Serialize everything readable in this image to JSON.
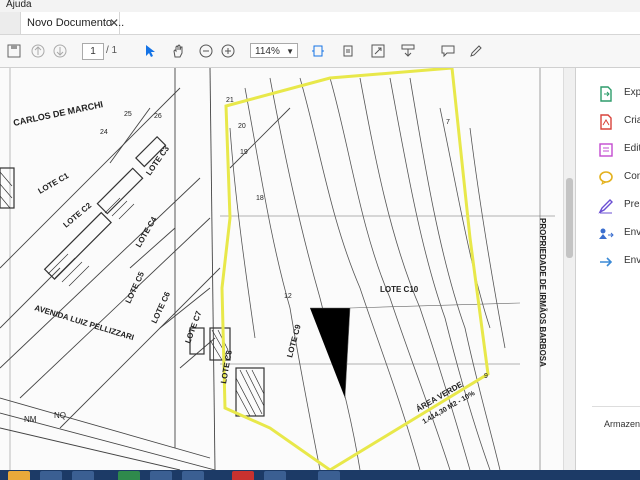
{
  "menubar": {
    "help_label": "Ajuda"
  },
  "tab": {
    "title": "Novo Documento ..."
  },
  "toolbar": {
    "page_current": "1",
    "page_total": "/ 1",
    "zoom": "114%"
  },
  "drawing": {
    "labels": {
      "carlos": "CARLOS DE MARCHI",
      "lote_c1": "LOTE C1",
      "lote_c2": "LOTE C2",
      "lote_c3": "LOTE C3",
      "lote_c4": "LOTE C4",
      "lote_c5": "LOTE C5",
      "lote_c6": "LOTE C6",
      "lote_c7": "LOTE C7",
      "lote_c8": "LOTE C8",
      "lote_c9": "LOTE C9",
      "lote_c10": "LOTE C10",
      "avenida": "AVENIDA LUIZ PELLIZZARI",
      "propriedade": "PROPRIEDADE DE IRMÃOS BARBOSA",
      "area_verde": "ÁREA VERDE",
      "area_verde_m2": "1.414,30 M2 - 10%",
      "nm": "NM",
      "nq": "NQ",
      "n21": "21",
      "n20": "20",
      "n19": "19",
      "n18": "18",
      "n12": "12",
      "n9": "9",
      "n7": "7",
      "n26": "26",
      "n25": "25",
      "n24": "24"
    }
  },
  "right_panel": {
    "items": [
      {
        "label": "Exp",
        "icon": "export-pdf-icon",
        "color": "#2e9c6b"
      },
      {
        "label": "Cria",
        "icon": "create-pdf-icon",
        "color": "#d9433b"
      },
      {
        "label": "Edit",
        "icon": "edit-pdf-icon",
        "color": "#c34bd0"
      },
      {
        "label": "Con",
        "icon": "comment-icon",
        "color": "#e4b21f"
      },
      {
        "label": "Pre",
        "icon": "fill-sign-icon",
        "color": "#6b4fd3"
      },
      {
        "label": "Env",
        "icon": "send-review-icon",
        "color": "#3b6fcf"
      },
      {
        "label": "Env",
        "icon": "send-track-icon",
        "color": "#3b8ad6"
      }
    ],
    "footer": "Armazen"
  },
  "colors": {
    "accent": "#1473e6",
    "highlight": "#e8e84a",
    "taskbar": "#1c3a66"
  }
}
